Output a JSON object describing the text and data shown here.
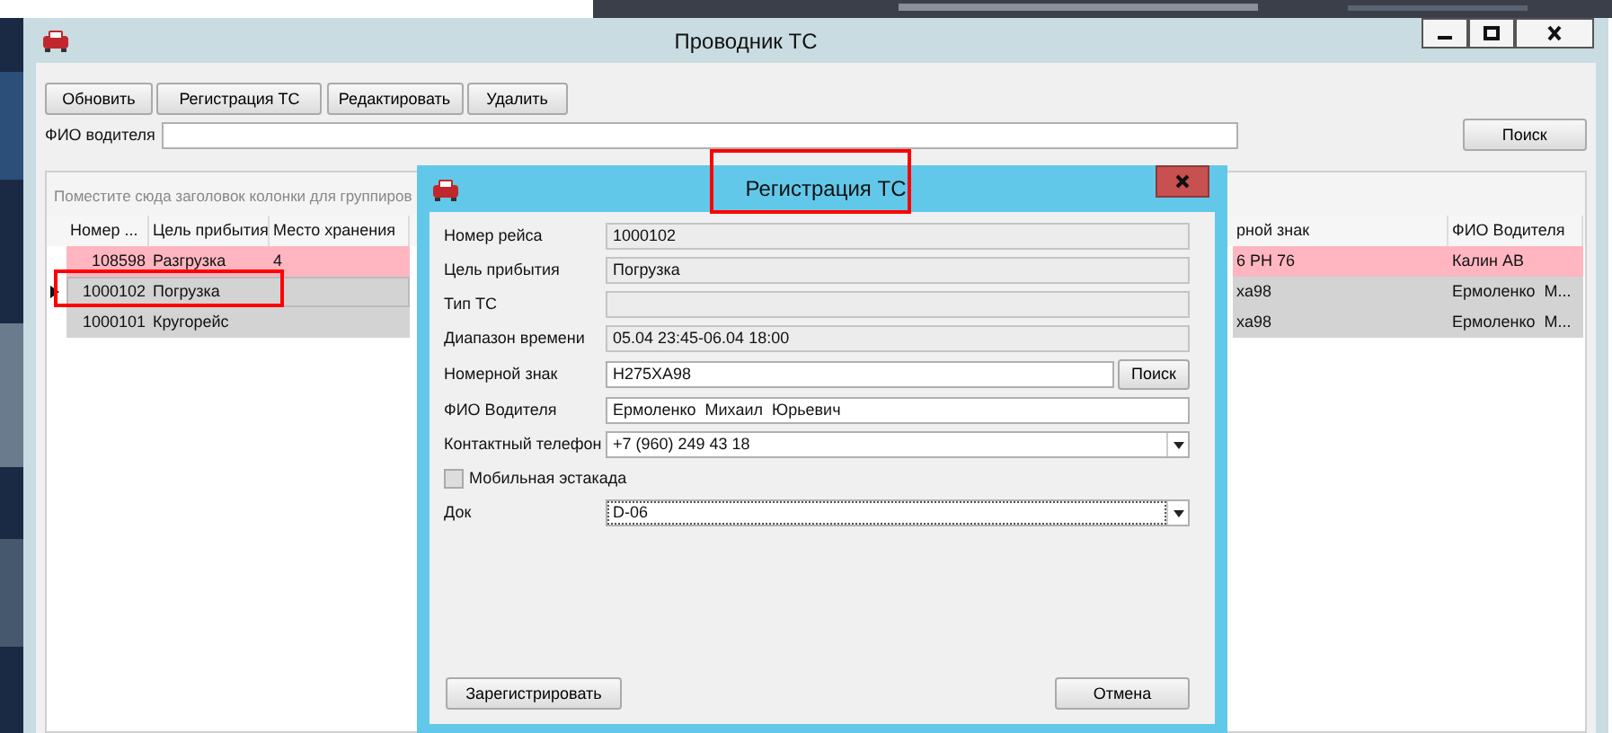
{
  "window": {
    "title": "Проводник ТС",
    "controls": [
      {
        "kind": "minimize"
      },
      {
        "kind": "maximize"
      },
      {
        "kind": "close"
      }
    ]
  },
  "toolbar": [
    "Обновить",
    "Регистрация ТС",
    "Редактировать",
    "Удалить"
  ],
  "filter": {
    "label": "ФИО водителя",
    "button": "Поиск"
  },
  "grid": {
    "group_hint": "Поместите сюда заголовок колонки для группиров",
    "columns": [
      {
        "label": "Номер ..."
      },
      {
        "label": "Цель прибытия"
      },
      {
        "label": "Место хранения"
      },
      {
        "label": "рной знак"
      },
      {
        "label": "ФИО Водителя"
      }
    ],
    "rows": [
      {
        "selected": false,
        "highlighted": false,
        "color": "#ffb6c1",
        "cells": [
          "108598",
          "Разгрузка",
          "4",
          "6 PH 76",
          "Калин АВ"
        ]
      },
      {
        "selected": true,
        "highlighted": true,
        "color": "#d3d3d3",
        "cells": [
          "1000102",
          "Погрузка",
          "",
          "xa98",
          "Ермоленко  М..."
        ]
      },
      {
        "selected": false,
        "highlighted": false,
        "color": "#d3d3d3",
        "cells": [
          "1000101",
          "Кругорейс",
          "",
          "xa98",
          "Ермоленко  М..."
        ]
      }
    ]
  },
  "dialog": {
    "title": "Регистрация ТС",
    "title_highlighted": true,
    "fields": [
      {
        "kind": "readonly",
        "label": "Номер рейса",
        "value": "1000102"
      },
      {
        "kind": "readonly",
        "label": "Цель прибытия",
        "value": "Погрузка"
      },
      {
        "kind": "readonly",
        "label": "Тип ТС"
      },
      {
        "kind": "readonly",
        "label": "Диапазон времени",
        "value": "05.04 23:45-06.04 18:00"
      },
      {
        "kind": "search",
        "label": "Номерной знак",
        "value": "H275XA98",
        "button": "Поиск"
      },
      {
        "kind": "input",
        "label": "ФИО Водителя",
        "value": "Ермоленко  Михаил  Юрьевич"
      },
      {
        "kind": "combo",
        "label": "Контактный телефон",
        "value": "+7 (960) 249 43 18",
        "focused": false
      },
      {
        "kind": "checkbox",
        "label": "Мобильная эстакада",
        "checked": false
      },
      {
        "kind": "combo",
        "label": "Док",
        "value": "D-06",
        "focused": true
      }
    ],
    "buttons": [
      "Зарегистрировать",
      "Отмена"
    ]
  }
}
